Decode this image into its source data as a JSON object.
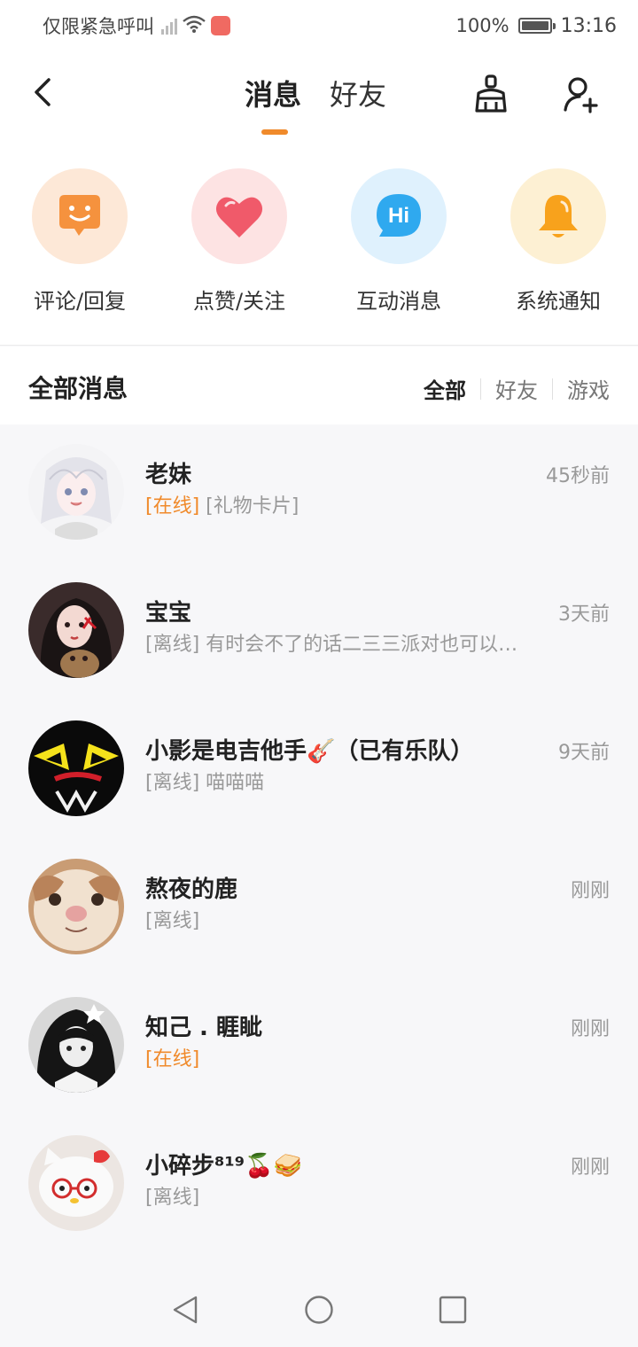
{
  "status_bar": {
    "carrier": "仅限紧急呼叫",
    "battery": "100%",
    "time": "13:16"
  },
  "header": {
    "tabs": [
      {
        "label": "消息",
        "active": true
      },
      {
        "label": "好友",
        "active": false
      }
    ],
    "icons": [
      "back-icon",
      "clean-broom-icon",
      "add-friend-icon"
    ]
  },
  "quick_actions": [
    {
      "label": "评论/回复",
      "icon": "smile-chat-icon",
      "bg": "#fde8d7",
      "color": "#f5923e"
    },
    {
      "label": "点赞/关注",
      "icon": "heart-icon",
      "bg": "#fde3e3",
      "color": "#f05a6a"
    },
    {
      "label": "互动消息",
      "icon": "hi-bubble-icon",
      "bg": "#dff1fd",
      "color": "#2fa9ef"
    },
    {
      "label": "系统通知",
      "icon": "bell-icon",
      "bg": "#fdf0d3",
      "color": "#f8a21c"
    }
  ],
  "messages_section": {
    "title": "全部消息",
    "filters": [
      {
        "label": "全部",
        "active": true
      },
      {
        "label": "好友",
        "active": false
      },
      {
        "label": "游戏",
        "active": false
      }
    ]
  },
  "conversations": [
    {
      "name": "老妹",
      "status": "[在线]",
      "online": true,
      "preview": "[礼物卡片]",
      "time": "45秒前"
    },
    {
      "name": "宝宝",
      "status": "[离线]",
      "online": false,
      "preview": "有时会不了的话二三三派对也可以…",
      "time": "3天前"
    },
    {
      "name": "小影是电吉他手🎸（已有乐队）",
      "status": "[离线]",
      "online": false,
      "preview": "喵喵喵",
      "time": "9天前"
    },
    {
      "name": "熬夜的鹿",
      "status": "[离线]",
      "online": false,
      "preview": "",
      "time": "刚刚"
    },
    {
      "name": "知己 . 睚眦",
      "status": "[在线]",
      "online": true,
      "preview": "",
      "time": "刚刚"
    },
    {
      "name": "小碎步⁸¹⁹🍒🥪",
      "status": "[离线]",
      "online": false,
      "preview": "",
      "time": "刚刚"
    }
  ],
  "colors": {
    "accent": "#f08a2b",
    "background": "#f7f7f9"
  }
}
